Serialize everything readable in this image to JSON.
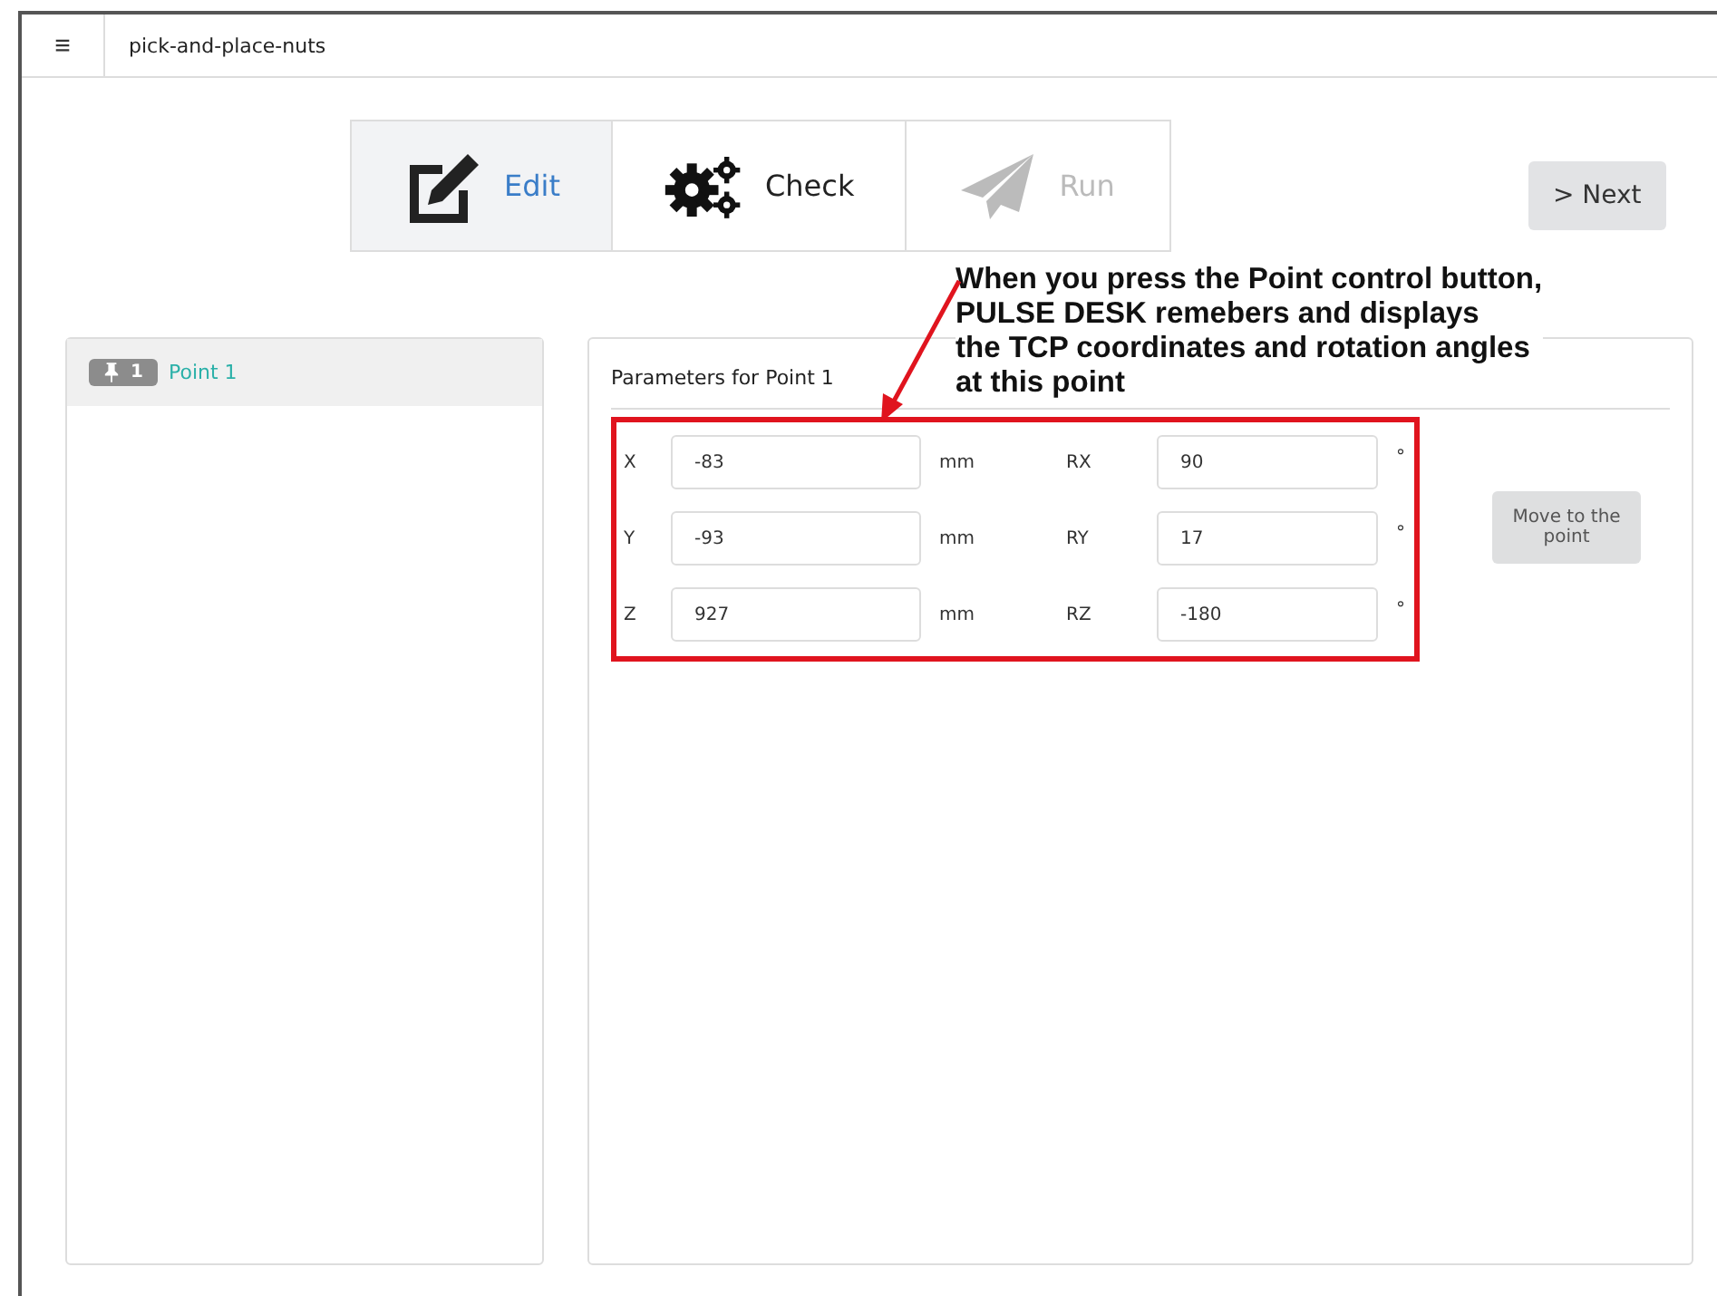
{
  "header": {
    "menu_glyph": "≡",
    "title": "pick-and-place-nuts"
  },
  "steps": [
    {
      "kind": "edit",
      "label": "Edit",
      "selected": true,
      "disabled": false
    },
    {
      "kind": "check",
      "label": "Check",
      "selected": false,
      "disabled": false
    },
    {
      "kind": "run",
      "label": "Run",
      "selected": false,
      "disabled": true
    }
  ],
  "next_button": {
    "glyph": ">",
    "label": "Next"
  },
  "points": [
    {
      "badge": "1",
      "label": "Point 1",
      "selected": true
    }
  ],
  "parameters": {
    "title": "Parameters for  Point 1",
    "rows": [
      {
        "label": "X",
        "value": "-83",
        "unit": "mm",
        "rlabel": "RX",
        "rvalue": "90",
        "runit": "°"
      },
      {
        "label": "Y",
        "value": "-93",
        "unit": "mm",
        "rlabel": "RY",
        "rvalue": "17",
        "runit": "°"
      },
      {
        "label": "Z",
        "value": "927",
        "unit": "mm",
        "rlabel": "RZ",
        "rvalue": "-180",
        "runit": "°"
      }
    ],
    "move_button": "Move to the point"
  },
  "annotation": {
    "text": "When you press the Point control button,\nPULSE DESK remebers and displays\nthe TCP coordinates and rotation angles\nat this point"
  }
}
